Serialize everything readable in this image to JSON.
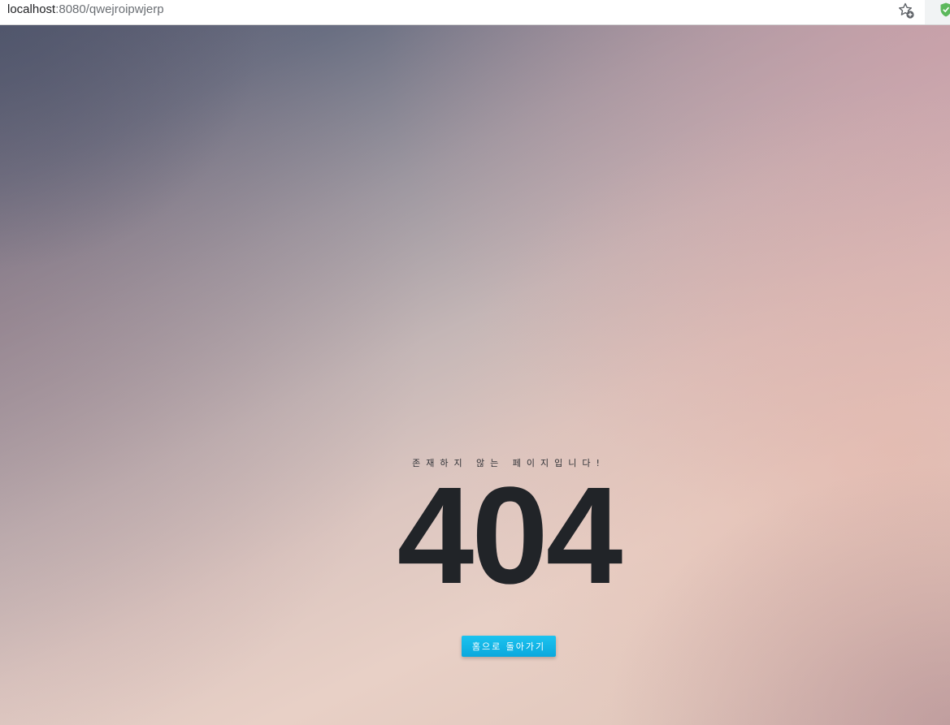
{
  "browser": {
    "url_host": "localhost",
    "url_rest": ":8080/qwejroipwjerp",
    "icons": [
      "bookmark-star-icon",
      "shield-icon"
    ],
    "shield_color": "#5cb85c"
  },
  "error_page": {
    "message": "존재하지 않는 페이지입니다!",
    "code": "404",
    "home_button_label": "홈으로 돌아가기",
    "button_color": "#0fb3e6",
    "code_color": "#212428"
  }
}
